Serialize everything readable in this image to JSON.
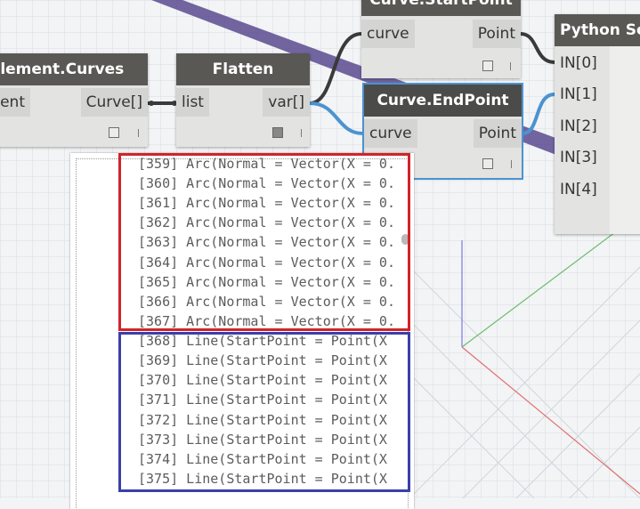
{
  "nodes": {
    "element_curves": {
      "title": "Element.Curves",
      "in_port": "Element",
      "out_port": "Curve[]"
    },
    "flatten": {
      "title": "Flatten",
      "in_port": "list",
      "out_port": "var[]"
    },
    "start_point": {
      "title": "Curve.StartPoint",
      "in_port": "curve",
      "out_port": "Point"
    },
    "end_point": {
      "title": "Curve.EndPoint",
      "in_port": "curve",
      "out_port": "Point"
    },
    "python_script": {
      "title": "Python Script",
      "in_ports": [
        "IN[0]",
        "IN[1]",
        "IN[2]",
        "IN[3]",
        "IN[4]"
      ]
    }
  },
  "preview": {
    "lines": [
      "[359] Arc(Normal = Vector(X = 0.",
      "[360] Arc(Normal = Vector(X = 0.",
      "[361] Arc(Normal = Vector(X = 0.",
      "[362] Arc(Normal = Vector(X = 0.",
      "[363] Arc(Normal = Vector(X = 0.",
      "[364] Arc(Normal = Vector(X = 0.",
      "[365] Arc(Normal = Vector(X = 0.",
      "[366] Arc(Normal = Vector(X = 0.",
      "[367] Arc(Normal = Vector(X = 0.",
      "[368] Line(StartPoint = Point(X",
      "[369] Line(StartPoint = Point(X",
      "[370] Line(StartPoint = Point(X",
      "[371] Line(StartPoint = Point(X",
      "[372] Line(StartPoint = Point(X",
      "[373] Line(StartPoint = Point(X",
      "[374] Line(StartPoint = Point(X",
      "[375] Line(StartPoint = Point(X"
    ]
  },
  "colors": {
    "red_highlight": "#d1232a",
    "blue_highlight": "#3b3fa8",
    "selected_wire": "#4b93d2",
    "wire": "#3a3a3a"
  }
}
